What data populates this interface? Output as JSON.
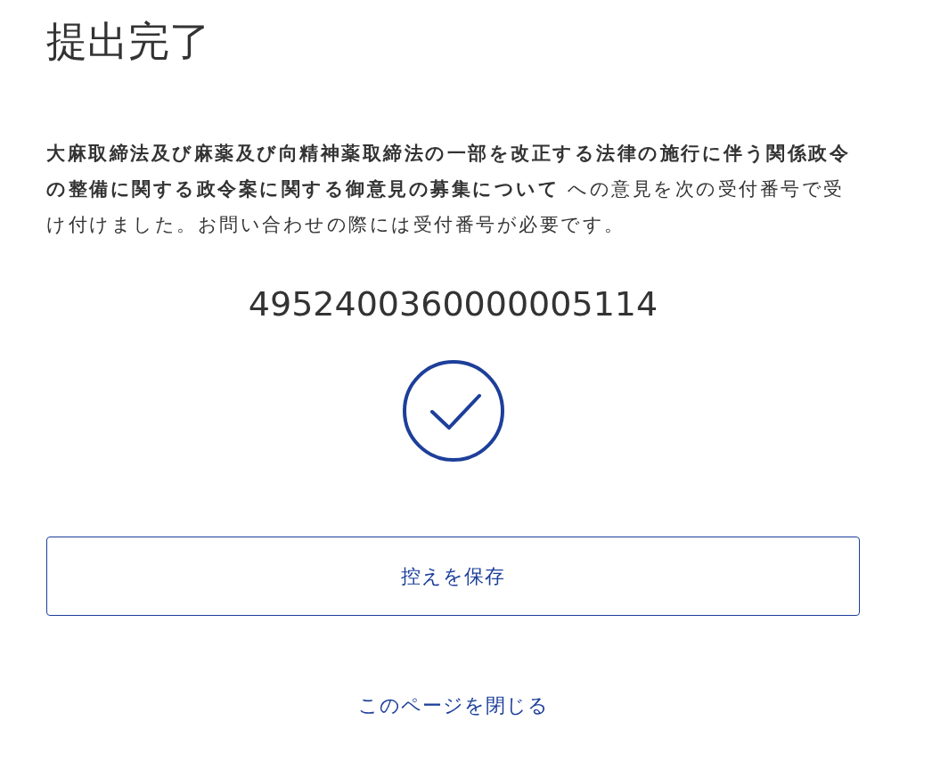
{
  "title": "提出完了",
  "message": "**大麻取締法及び麻薬及び向精神薬取締法の一部を改正する法律の施行に伴う関係政令の整備に関する政令案に関する御意見の募集について** への意見を次の受付番号で受け付けました。お問い合わせの際には受付番号が必要です。",
  "receipt_number": "4952400360000005114",
  "save_button": "控えを保存",
  "close_link": "このページを閉じる"
}
